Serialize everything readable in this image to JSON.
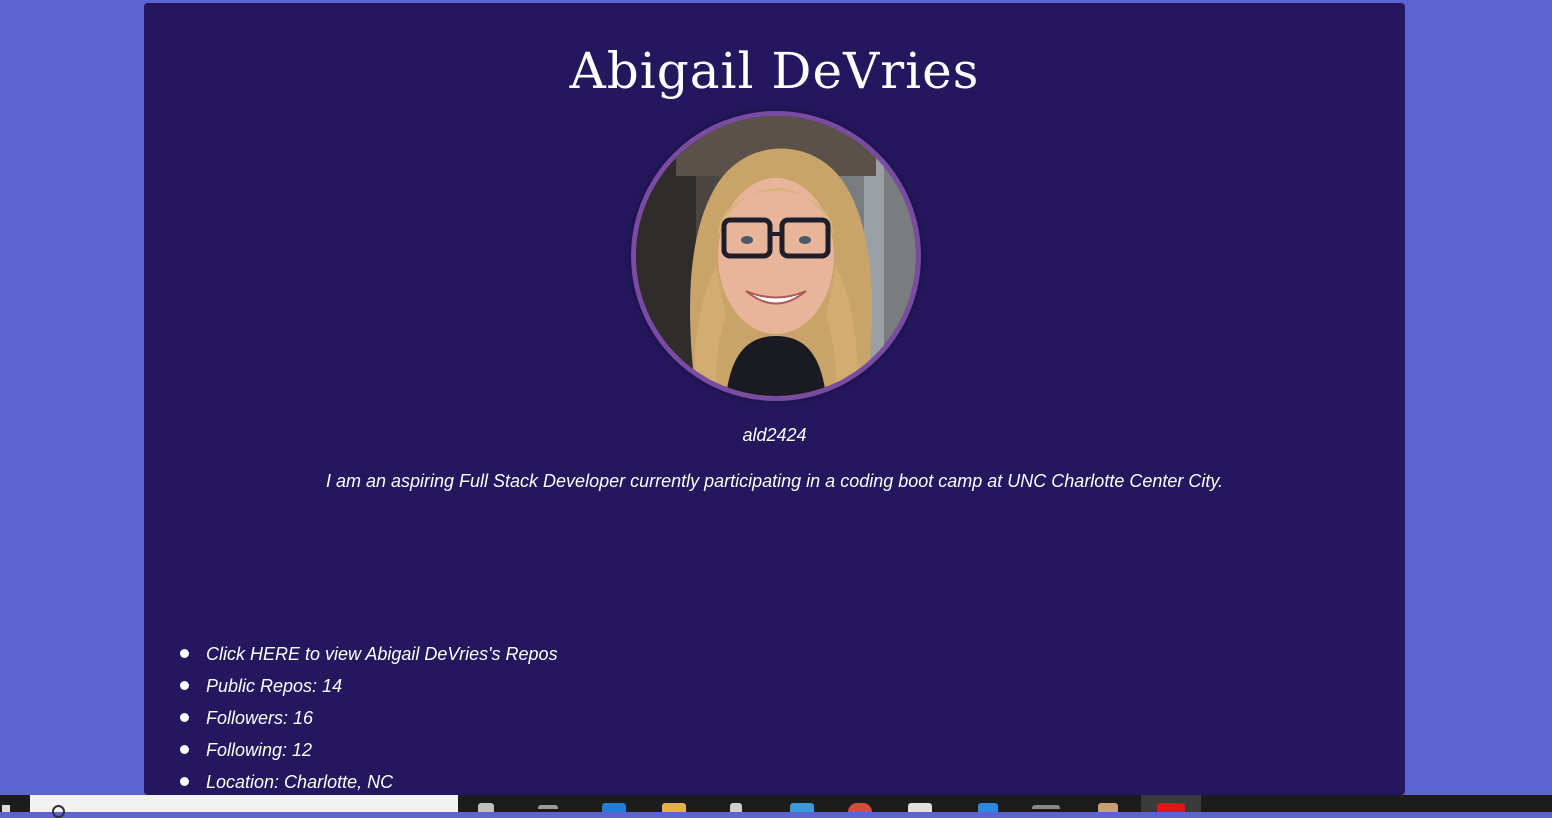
{
  "profile": {
    "name": "Abigail DeVries",
    "username": "ald2424",
    "bio": "I am an aspiring Full Stack Developer currently participating in a coding boot camp at UNC Charlotte Center City."
  },
  "stats": {
    "repos_link": "Click HERE to view Abigail DeVries's Repos",
    "public_repos": "Public Repos: 14",
    "followers": "Followers: 16",
    "following": "Following: 12",
    "location": "Location: Charlotte, NC"
  },
  "colors": {
    "page_background": "#5c63d2",
    "card_background": "#24175d",
    "avatar_border": "#7a4ba3",
    "text": "#ffffff"
  },
  "taskbar": {
    "icons": [
      "start-icon",
      "search-icon",
      "cortana-icon",
      "task-view-icon",
      "edge-icon",
      "file-explorer-icon",
      "settings-icon",
      "store-icon",
      "chrome-icon",
      "notepad-icon",
      "vscode-icon",
      "terminal-icon",
      "paint-icon",
      "active-app-icon"
    ]
  }
}
